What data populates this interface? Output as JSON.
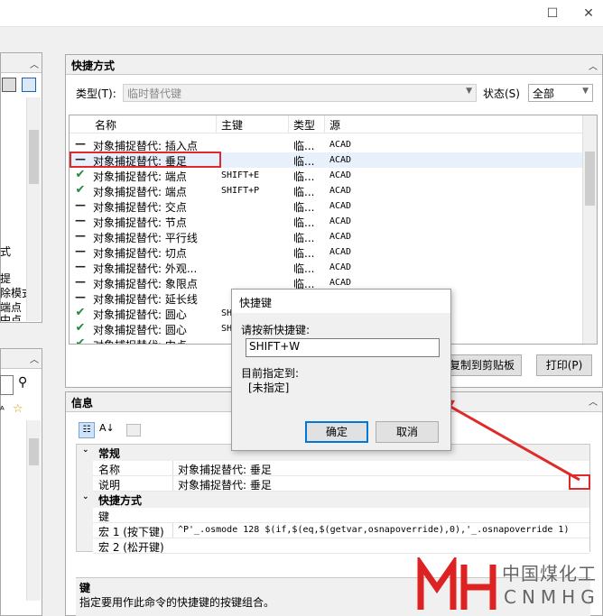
{
  "window": {
    "maximize_glyph": "☐",
    "close_glyph": "✕"
  },
  "shortcuts_panel": {
    "title": "快捷方式",
    "type_label": "类型(T):",
    "type_value": "临时替代键",
    "status_label": "状态(S)",
    "status_value": "全部",
    "columns": {
      "name": "名称",
      "key": "主键",
      "type": "类型",
      "source": "源"
    },
    "rows": [
      {
        "icon": "dash",
        "name": "对象捕捉替代: 插入点",
        "key": "",
        "type": "临...",
        "source": "ACAD"
      },
      {
        "icon": "dash",
        "name": "对象捕捉替代: 垂足",
        "key": "",
        "type": "临...",
        "source": "ACAD"
      },
      {
        "icon": "check",
        "name": "对象捕捉替代: 端点",
        "key": "SHIFT+E",
        "type": "临...",
        "source": "ACAD"
      },
      {
        "icon": "check",
        "name": "对象捕捉替代: 端点",
        "key": "SHIFT+P",
        "type": "临...",
        "source": "ACAD"
      },
      {
        "icon": "dash",
        "name": "对象捕捉替代: 交点",
        "key": "",
        "type": "临...",
        "source": "ACAD"
      },
      {
        "icon": "dash",
        "name": "对象捕捉替代: 节点",
        "key": "",
        "type": "临...",
        "source": "ACAD"
      },
      {
        "icon": "dash",
        "name": "对象捕捉替代: 平行线",
        "key": "",
        "type": "临...",
        "source": "ACAD"
      },
      {
        "icon": "dash",
        "name": "对象捕捉替代: 切点",
        "key": "",
        "type": "临...",
        "source": "ACAD"
      },
      {
        "icon": "dash",
        "name": "对象捕捉替代: 外观...",
        "key": "",
        "type": "临...",
        "source": "ACAD"
      },
      {
        "icon": "dash",
        "name": "对象捕捉替代: 象限点",
        "key": "",
        "type": "临...",
        "source": "ACAD"
      },
      {
        "icon": "dash",
        "name": "对象捕捉替代: 延长线",
        "key": "",
        "type": "临...",
        "source": "ACAD"
      },
      {
        "icon": "check",
        "name": "对象捕捉替代: 圆心",
        "key": "SH",
        "type": "",
        "source": ""
      },
      {
        "icon": "check",
        "name": "对象捕捉替代: 圆心",
        "key": "SH",
        "type": "",
        "source": ""
      },
      {
        "icon": "check",
        "name": "对象捕捉替代: 中点",
        "key": "",
        "type": "",
        "source": ""
      }
    ],
    "copy_button": "复制到剪贴板",
    "print_button": "打印(P)"
  },
  "left_panel": {
    "frag_1": "式",
    "frag_2": "提",
    "frag_3": "除模式",
    "frag_4": "端点",
    "frag_5": "中点"
  },
  "info_panel": {
    "title": "信息",
    "groups": [
      {
        "label": "常规",
        "rows": [
          {
            "key": "名称",
            "value": "对象捕捉替代: 垂足"
          },
          {
            "key": "说明",
            "value": "对象捕捉替代: 垂足"
          }
        ]
      },
      {
        "label": "快捷方式",
        "rows": [
          {
            "key": "键",
            "value": ""
          },
          {
            "key": "宏 1 (按下键)",
            "value": "^P'_.osmode 128 $(if,$(eq,$(getvar,osnapoverride),0),'_.osnapoverride 1)"
          },
          {
            "key": "宏 2 (松开键)",
            "value": ""
          }
        ]
      }
    ],
    "desc_title": "键",
    "desc_text": "指定要用作此命令的快捷键的按键组合。"
  },
  "dialog": {
    "title": "快捷键",
    "prompt": "请按新快捷键:",
    "input_value": "SHIFT+W",
    "assigned_label": "目前指定到:",
    "assigned_value": "[未指定]",
    "ok": "确定",
    "cancel": "取消"
  },
  "watermark": {
    "cn": "中国煤化工",
    "en": "CNMHG"
  },
  "colors": {
    "accent": "#0078d7",
    "highlight": "#e02a2a",
    "check": "#1e8a3a"
  }
}
